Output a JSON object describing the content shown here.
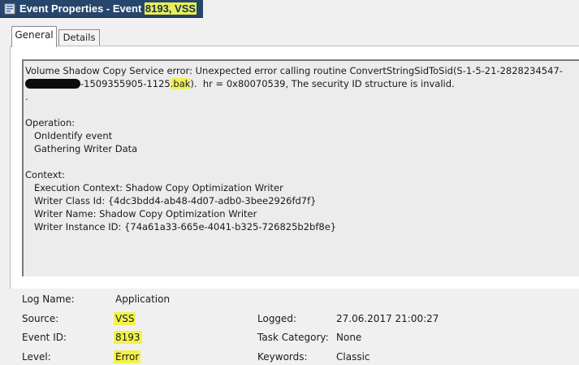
{
  "window": {
    "title_prefix": "Event Properties - Event ",
    "title_highlight": "8193, VSS",
    "title_icon": "event-viewer-icon"
  },
  "tabs": [
    {
      "label": "General",
      "selected": true
    },
    {
      "label": "Details",
      "selected": false
    }
  ],
  "description": {
    "line1": "Volume Shadow Copy Service error: Unexpected error calling routine ConvertStringSidToSid(S-1-5-21-2828234547-",
    "line2_after_redaction": "-1509355905-1125",
    "line2_highlight": ".bak",
    "line2_tail": ").  hr = 0x80070539, The security ID structure is invalid.",
    "line3": ".",
    "operation_header": "Operation:",
    "operation_items": [
      "OnIdentify event",
      "Gathering Writer Data"
    ],
    "context_header": "Context:",
    "context_items": [
      "Execution Context: Shadow Copy Optimization Writer",
      "Writer Class Id: {4dc3bdd4-ab48-4d07-adb0-3bee2926fd7f}",
      "Writer Name: Shadow Copy Optimization Writer",
      "Writer Instance ID: {74a61a33-665e-4041-b325-726825b2bf8e}"
    ]
  },
  "fields": {
    "log_name": {
      "label": "Log Name:",
      "value": "Application"
    },
    "source": {
      "label": "Source:",
      "value": "VSS"
    },
    "event_id": {
      "label": "Event ID:",
      "value": "8193"
    },
    "level": {
      "label": "Level:",
      "value": "Error"
    },
    "logged": {
      "label": "Logged:",
      "value": "27.06.2017 21:00:27"
    },
    "task_category": {
      "label": "Task Category:",
      "value": "None"
    },
    "keywords": {
      "label": "Keywords:",
      "value": "Classic"
    }
  },
  "colors": {
    "titlebar": "#27466b",
    "highlight": "#f2f24d",
    "window_bg": "#f0f0f0",
    "description_bg": "#ececec"
  }
}
